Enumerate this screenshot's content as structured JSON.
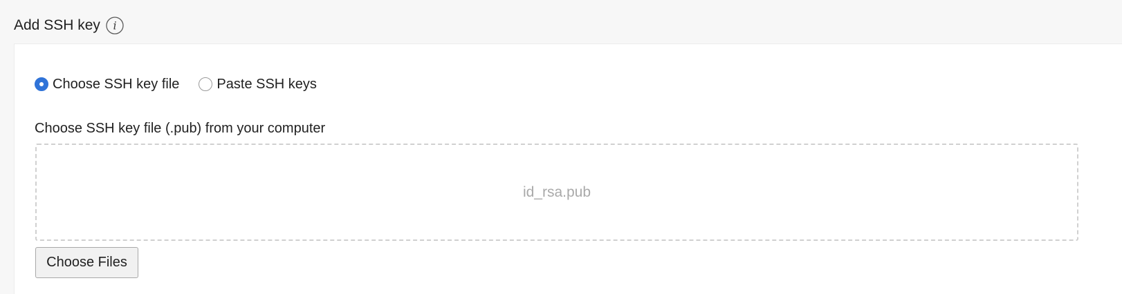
{
  "header": {
    "title": "Add SSH key",
    "info_icon": "info-icon"
  },
  "source_options": {
    "selected": "Choose SSH key file",
    "options": [
      {
        "label": "Choose SSH key file",
        "checked": true
      },
      {
        "label": "Paste SSH keys",
        "checked": false
      }
    ]
  },
  "file_field": {
    "label": "Choose SSH key file (.pub) from your computer",
    "placeholder": "id_rsa.pub",
    "button_label": "Choose Files"
  },
  "colors": {
    "accent": "#2f73d8",
    "placeholder_text": "#a9a9a9",
    "dashed_border": "#d0d0d0"
  }
}
